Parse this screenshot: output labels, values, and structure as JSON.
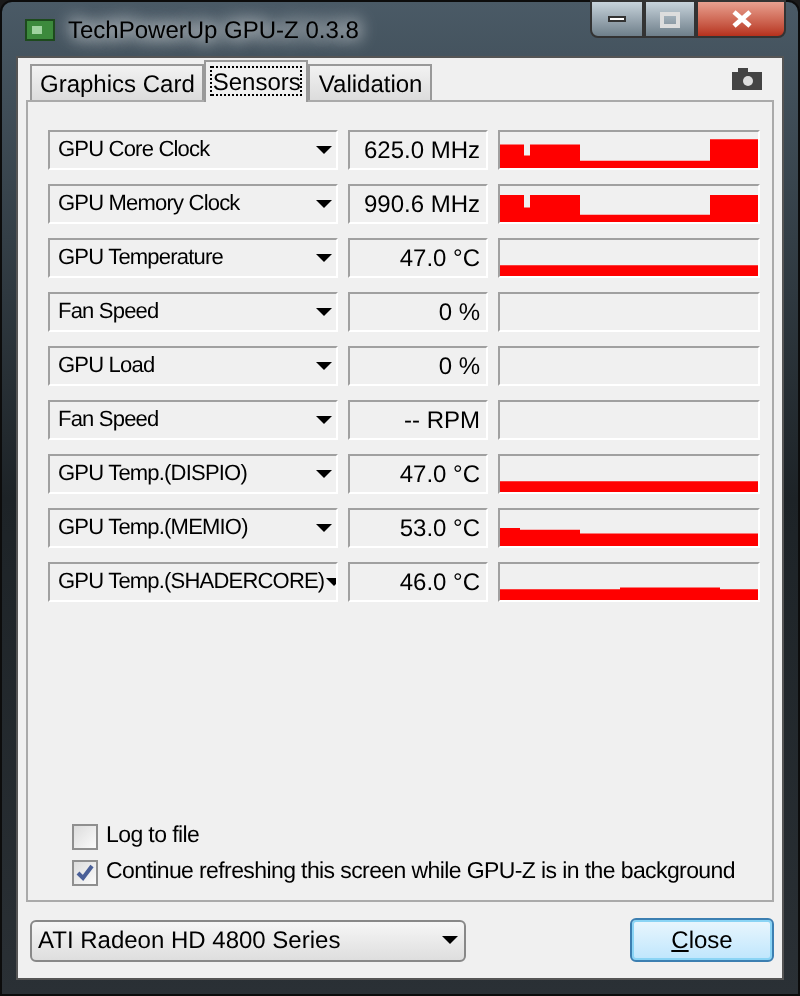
{
  "window": {
    "title": "TechPowerUp GPU-Z 0.3.8"
  },
  "tabs": [
    {
      "label": "Graphics Card",
      "selected": false
    },
    {
      "label": "Sensors",
      "selected": true
    },
    {
      "label": "Validation",
      "selected": false
    }
  ],
  "sensors": [
    {
      "name": "GPU Core Clock",
      "reading": "625.0 MHz"
    },
    {
      "name": "GPU Memory Clock",
      "reading": "990.6 MHz"
    },
    {
      "name": "GPU Temperature",
      "reading": "47.0 °C"
    },
    {
      "name": "Fan Speed",
      "reading": "0 %"
    },
    {
      "name": "GPU Load",
      "reading": "0 %"
    },
    {
      "name": "Fan Speed",
      "reading": "-- RPM"
    },
    {
      "name": "GPU Temp.(DISPIO)",
      "reading": "47.0 °C"
    },
    {
      "name": "GPU Temp.(MEMIO)",
      "reading": "53.0 °C"
    },
    {
      "name": "GPU Temp.(SHADERCORE)",
      "reading": "46.0 °C"
    }
  ],
  "options": [
    {
      "label": "Log to file",
      "checked": false
    },
    {
      "label": "Continue refreshing this screen while GPU-Z is in the background",
      "checked": true
    }
  ],
  "device_select": {
    "value": "ATI Radeon HD 4800 Series"
  },
  "close_button": {
    "label": "Close"
  }
}
